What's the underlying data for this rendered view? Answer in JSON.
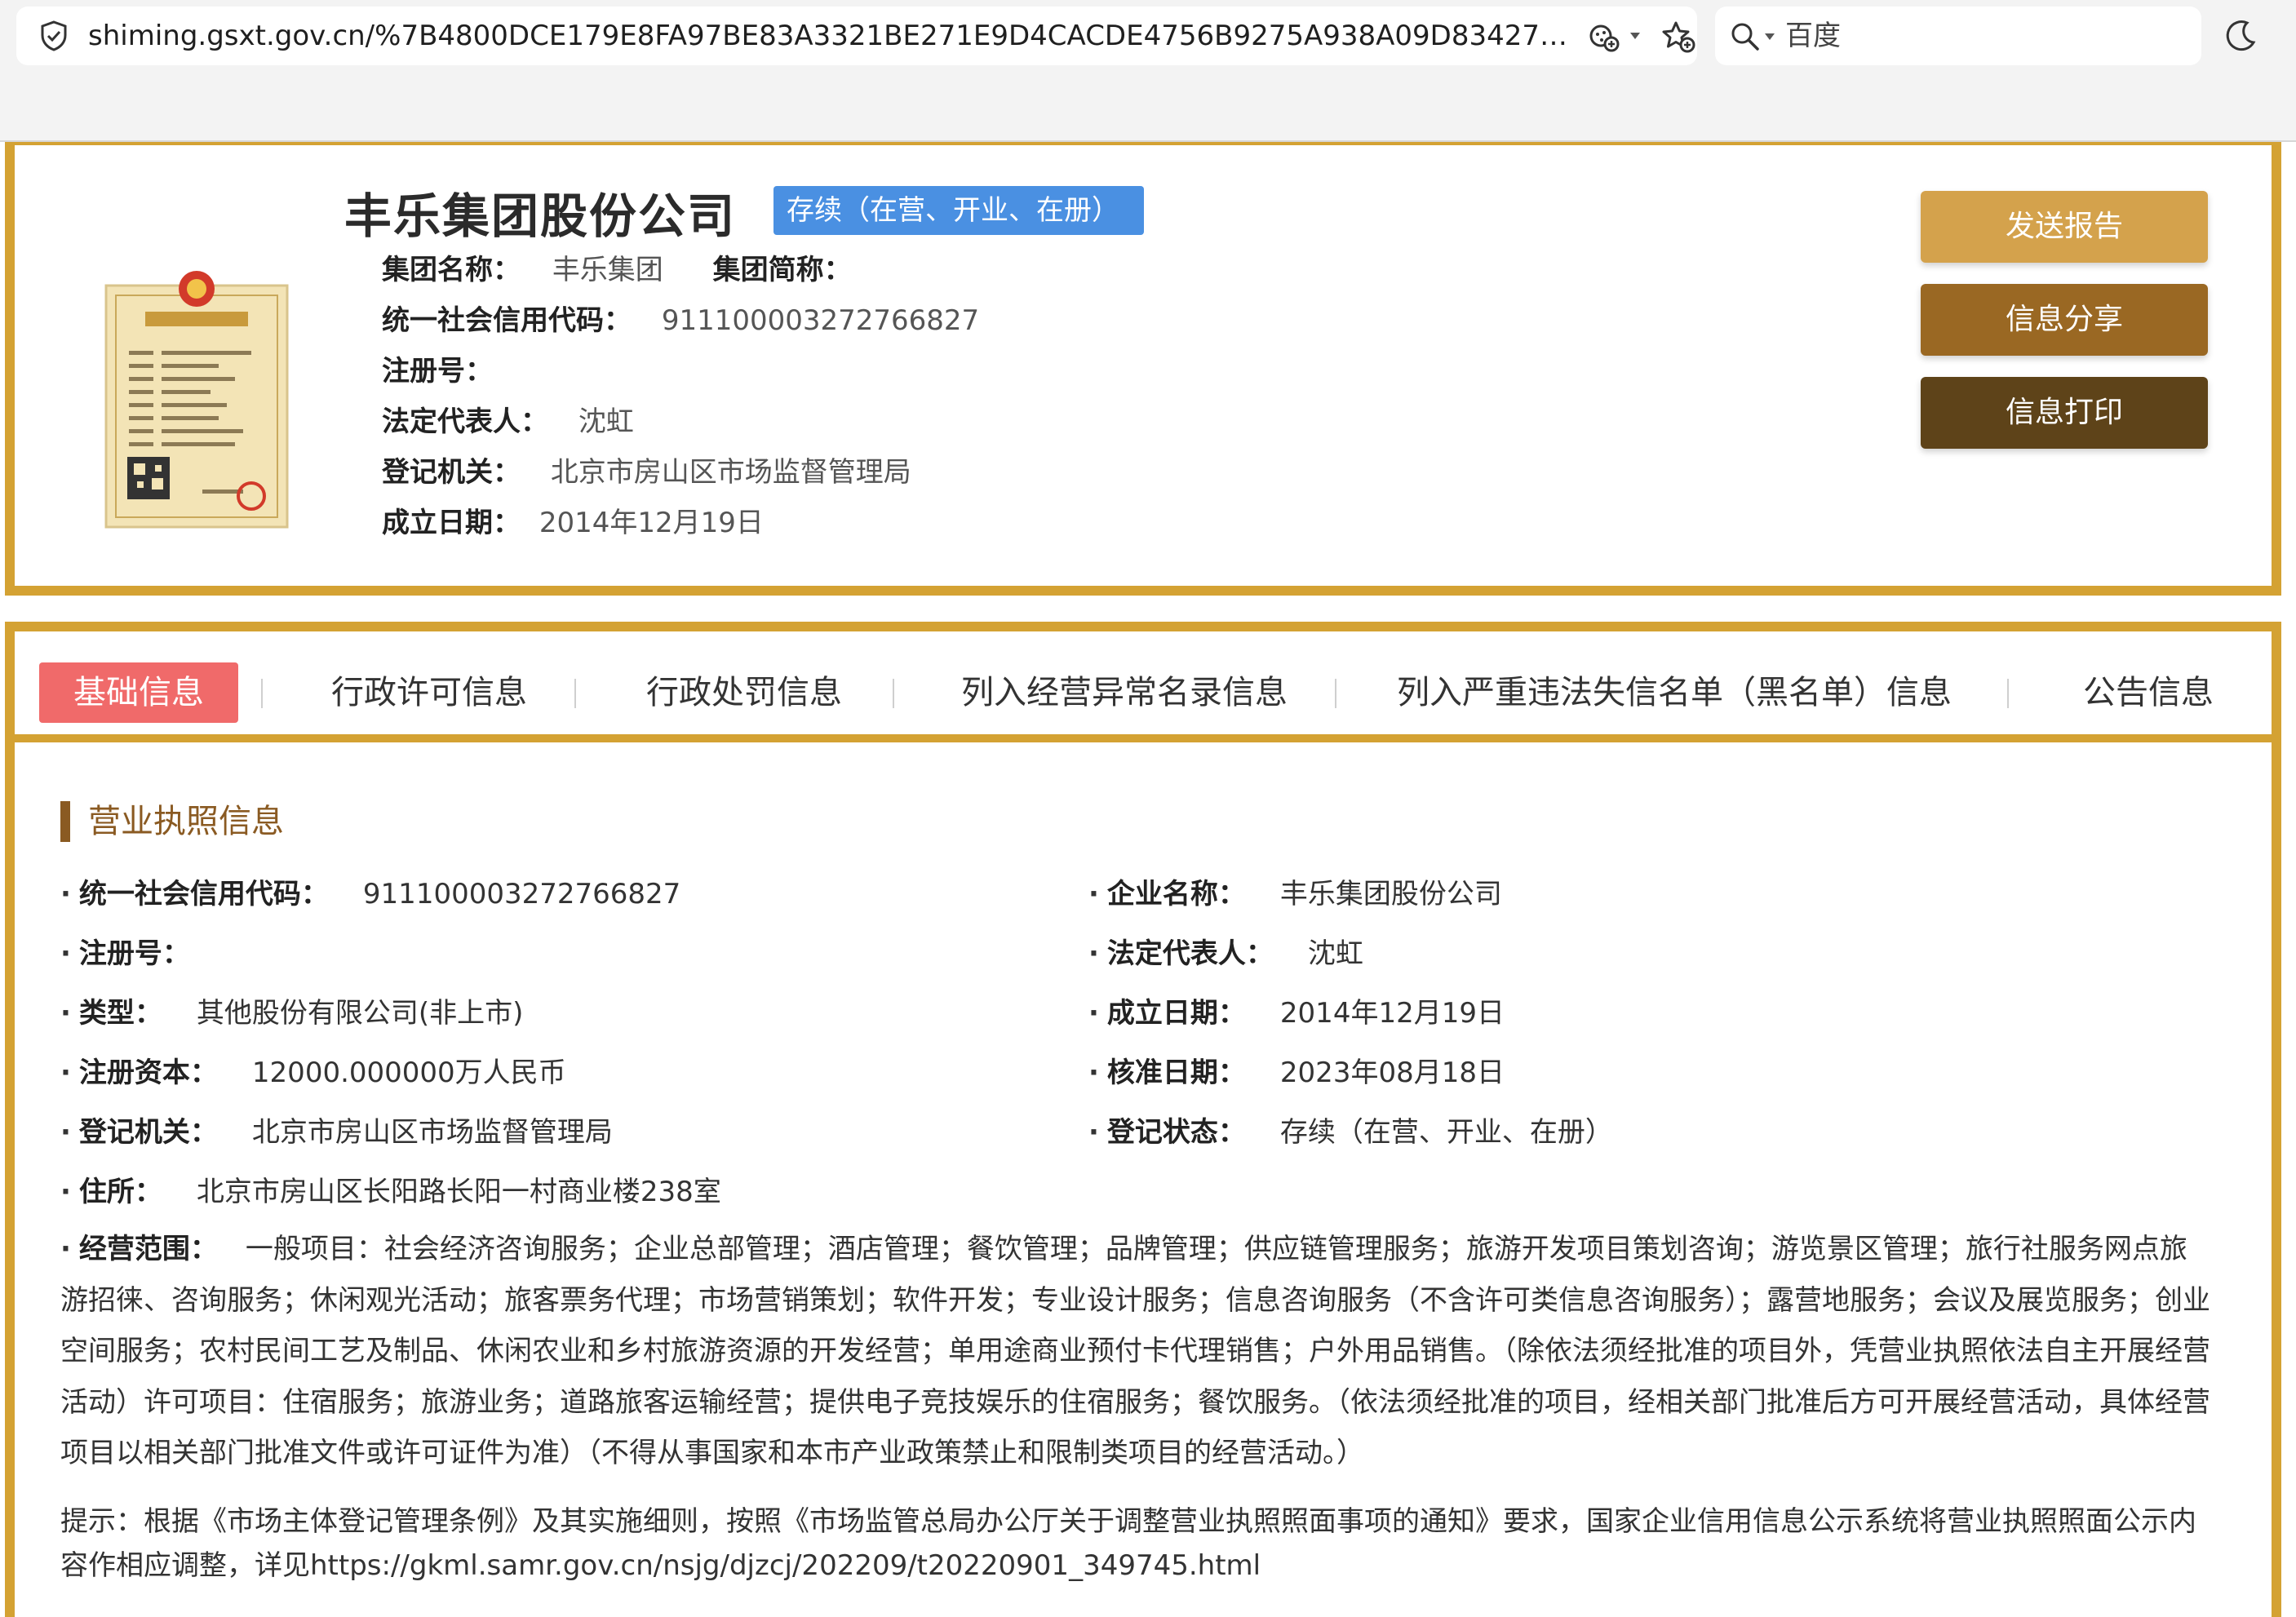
{
  "browser": {
    "url": "shiming.gsxt.gov.cn/%7B4800DCE179E8FA97BE83A3321BE271E9D4CACDE4756B9275A938A09D8342714...",
    "search_placeholder": "百度"
  },
  "header": {
    "company_name": "丰乐集团股份公司",
    "status": "存续（在营、开业、在册）",
    "group_name_label": "集团名称：",
    "group_name": "丰乐集团",
    "group_short_label": "集团简称：",
    "group_short": "",
    "credit_code_label": "统一社会信用代码：",
    "credit_code": "911100003272766827",
    "reg_no_label": "注册号：",
    "reg_no": "",
    "legal_rep_label": "法定代表人：",
    "legal_rep": "沈虹",
    "authority_label": "登记机关：",
    "authority": "北京市房山区市场监督管理局",
    "founded_label": "成立日期：",
    "founded": "2014年12月19日"
  },
  "actions": {
    "send_report": "发送报告",
    "share": "信息分享",
    "print": "信息打印"
  },
  "tabs": [
    "基础信息",
    "行政许可信息",
    "行政处罚信息",
    "列入经营异常名录信息",
    "列入严重违法失信名单（黑名单）信息",
    "公告信息"
  ],
  "license": {
    "section_title": "营业执照信息",
    "credit_code_label": "统一社会信用代码：",
    "credit_code": "911100003272766827",
    "company_name_label": "企业名称：",
    "company_name": "丰乐集团股份公司",
    "reg_no_label": "注册号：",
    "reg_no": "",
    "legal_rep_label": "法定代表人：",
    "legal_rep": "沈虹",
    "type_label": "类型：",
    "type": "其他股份有限公司(非上市)",
    "founded_label": "成立日期：",
    "founded": "2014年12月19日",
    "capital_label": "注册资本：",
    "capital": "12000.000000万人民币",
    "approved_label": "核准日期：",
    "approved": "2023年08月18日",
    "authority_label": "登记机关：",
    "authority": "北京市房山区市场监督管理局",
    "reg_status_label": "登记状态：",
    "reg_status": "存续（在营、开业、在册）",
    "address_label": "住所：",
    "address": "北京市房山区长阳路长阳一村商业楼238室",
    "scope_label": "经营范围：",
    "scope": "一般项目：社会经济咨询服务；企业总部管理；酒店管理；餐饮管理；品牌管理；供应链管理服务；旅游开发项目策划咨询；游览景区管理；旅行社服务网点旅游招徕、咨询服务；休闲观光活动；旅客票务代理；市场营销策划；软件开发；专业设计服务；信息咨询服务（不含许可类信息咨询服务）；露营地服务；会议及展览服务；创业空间服务；农村民间工艺及制品、休闲农业和乡村旅游资源的开发经营；单用途商业预付卡代理销售；户外用品销售。（除依法须经批准的项目外，凭营业执照依法自主开展经营活动）许可项目：住宿服务；旅游业务；道路旅客运输经营；提供电子竞技娱乐的住宿服务；餐饮服务。（依法须经批准的项目，经相关部门批准后方可开展经营活动，具体经营项目以相关部门批准文件或许可证件为准）（不得从事国家和本市产业政策禁止和限制类项目的经营活动。）",
    "tip": "提示：根据《市场主体登记管理条例》及其实施细则，按照《市场监管总局办公厅关于调整营业执照照面事项的通知》要求，国家企业信用信息公示系统将营业执照照面公示内容作相应调整，详见https://gkml.samr.gov.cn/nsjg/djzcj/202209/t20220901_349745.html"
  }
}
